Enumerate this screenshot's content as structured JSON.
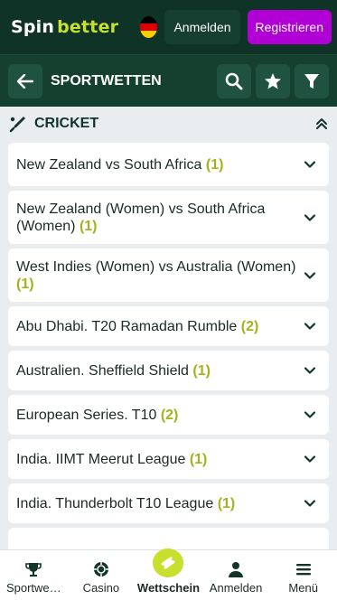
{
  "header": {
    "logo_part1": "Spin",
    "logo_part2": "better",
    "language_flag": "germany-flag",
    "login_label": "Anmelden",
    "register_label": "Registrieren"
  },
  "subheader": {
    "title": "SPORTWETTEN",
    "back_icon": "arrow-left-icon",
    "search_icon": "search-icon",
    "favorites_icon": "star-icon",
    "filter_icon": "filter-icon"
  },
  "sport": {
    "title": "CRICKET",
    "icon": "cricket-bat-icon",
    "collapse_icon": "double-chevron-up-icon"
  },
  "leagues": [
    {
      "name": "New Zealand vs South Africa",
      "count": "(1)"
    },
    {
      "name": "New Zealand (Women) vs South Africa (Women)",
      "count": "(1)"
    },
    {
      "name": "West Indies (Women) vs Australia (Women)",
      "count": "(1)"
    },
    {
      "name": "Abu Dhabi. T20 Ramadan Rumble",
      "count": "(2)"
    },
    {
      "name": "Australien. Sheffield Shield",
      "count": "(1)"
    },
    {
      "name": "European Series. T10",
      "count": "(2)"
    },
    {
      "name": "India. IIMT Meerut League",
      "count": "(1)"
    },
    {
      "name": "India. Thunderbolt T10 League",
      "count": "(1)"
    }
  ],
  "bottom_nav": [
    {
      "label": "Sportwe…",
      "icon": "trophy-icon"
    },
    {
      "label": "Casino",
      "icon": "casino-chip-icon"
    },
    {
      "label": "Wettschein",
      "icon": "ticket-icon",
      "active": true
    },
    {
      "label": "Anmelden",
      "icon": "user-icon"
    },
    {
      "label": "Menü",
      "icon": "menu-icon"
    }
  ],
  "colors": {
    "header_bg": "#0f3327",
    "accent_lime": "#c6e02d",
    "register_purple": "#b100d6",
    "count_color": "#a3b31e"
  }
}
